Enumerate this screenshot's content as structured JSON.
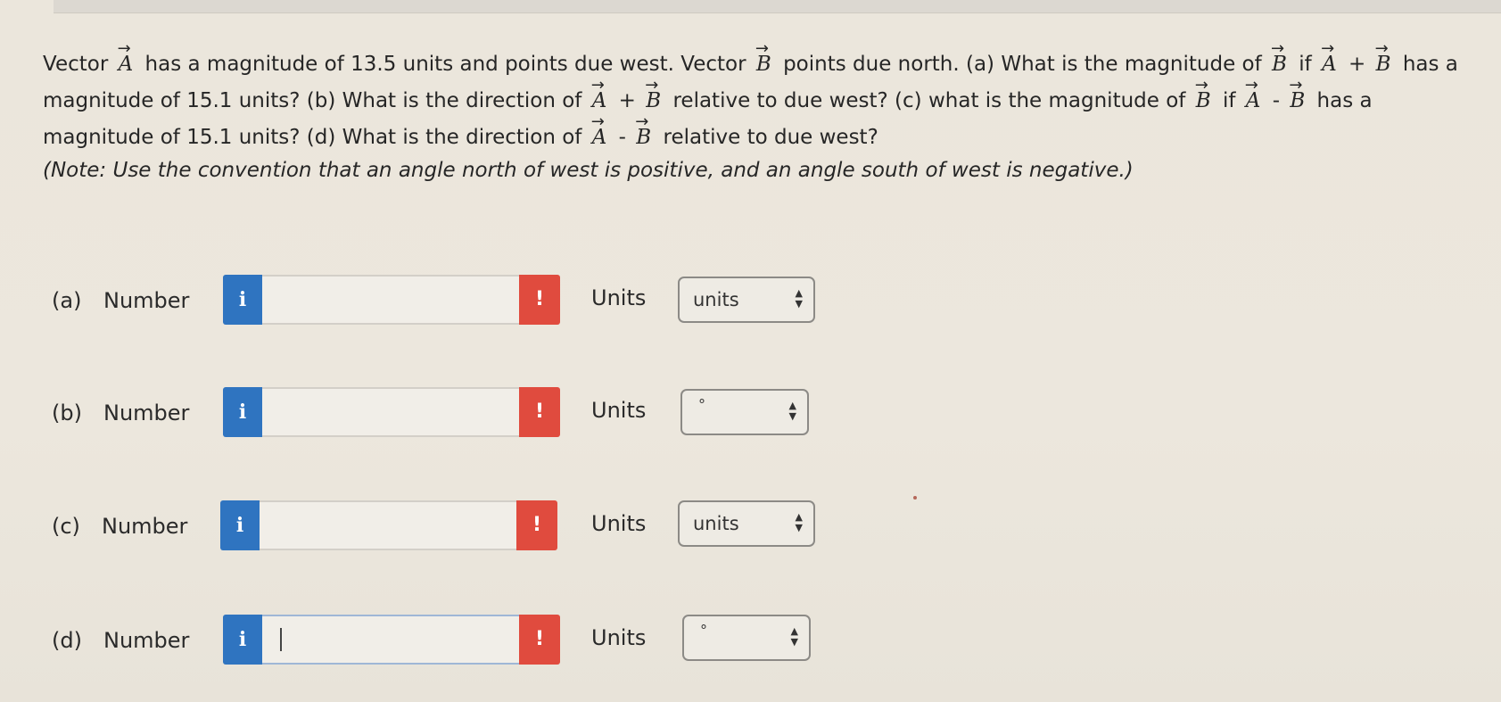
{
  "question": {
    "line1": {
      "t1": "Vector",
      "vecA": "A",
      "t2": "has a magnitude of 13.5 units and points due west. Vector",
      "vecB": "B",
      "t3": "points due north. (a) What is the magnitude of",
      "t4": "if",
      "t5": "+",
      "t6": "has a"
    },
    "line2": {
      "t1": "magnitude of 15.1 units? (b) What is the direction of",
      "t2": "+",
      "t3": "relative to due west? (c) what is the magnitude of",
      "t4": "if",
      "t5": "-",
      "t6": "has a"
    },
    "line3": {
      "t1": "magnitude of 15.1 units? (d) What is the direction of",
      "t2": "-",
      "t3": "relative to due west?"
    },
    "note": "(Note: Use the convention that an angle north of west is positive, and an angle south of west is negative.)"
  },
  "parts": [
    {
      "label": "(a)",
      "number_label": "Number",
      "info": "i",
      "warn": "!",
      "value": "",
      "units_label": "Units",
      "units_value": "units"
    },
    {
      "label": "(b)",
      "number_label": "Number",
      "info": "i",
      "warn": "!",
      "value": "",
      "units_label": "Units",
      "units_value": "°"
    },
    {
      "label": "(c)",
      "number_label": "Number",
      "info": "i",
      "warn": "!",
      "value": "",
      "units_label": "Units",
      "units_value": "units"
    },
    {
      "label": "(d)",
      "number_label": "Number",
      "info": "i",
      "warn": "!",
      "value": "",
      "units_label": "Units",
      "units_value": "°"
    }
  ],
  "colors": {
    "info_button": "#2f74c0",
    "warn_button": "#e04b3e",
    "background": "#ece7dd"
  },
  "icons": {
    "select_arrows": "up-down-arrows-icon",
    "info": "info-icon",
    "warning": "exclamation-icon"
  }
}
